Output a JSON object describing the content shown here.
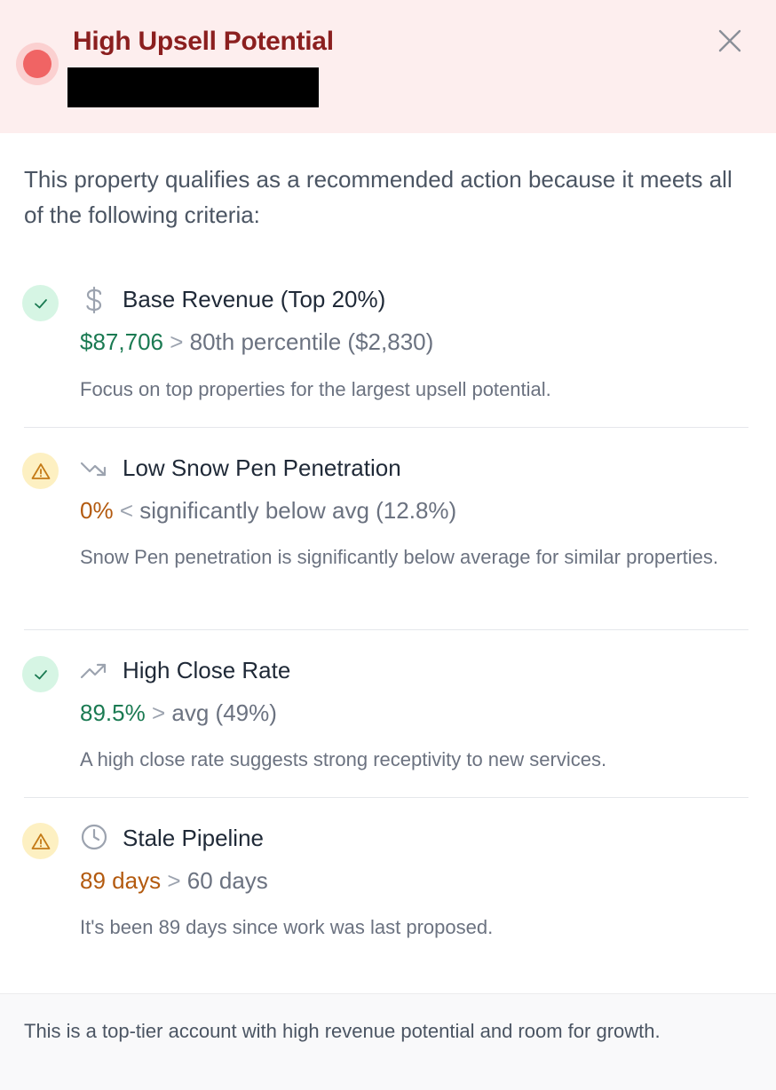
{
  "header": {
    "title": "High Upsell Potential",
    "status_color": "#f06464"
  },
  "intro": "This property qualifies as a recommended action because it meets all of the following criteria:",
  "criteria": [
    {
      "status": "ok",
      "icon": "dollar-icon",
      "title": "Base Revenue (Top 20%)",
      "value": "$87,706",
      "comparator": ">",
      "reference": "80th percentile ($2,830)",
      "description": "Focus on top properties for the largest upsell potential."
    },
    {
      "status": "warning",
      "icon": "trending-down-icon",
      "title": "Low Snow Pen Penetration",
      "value": "0%",
      "comparator": "<",
      "reference": "significantly below avg (12.8%)",
      "description": "Snow Pen penetration is significantly below average for similar properties."
    },
    {
      "status": "ok",
      "icon": "trending-up-icon",
      "title": "High Close Rate",
      "value": "89.5%",
      "comparator": ">",
      "reference": "avg (49%)",
      "description": "A high close rate suggests strong receptivity to new services."
    },
    {
      "status": "warning",
      "icon": "clock-icon",
      "title": "Stale Pipeline",
      "value": "89 days",
      "comparator": ">",
      "reference": "60 days",
      "description": "It's been 89 days since work was last proposed."
    }
  ],
  "footer": {
    "summary": "This is a top-tier account with high revenue potential and room for growth."
  },
  "colors": {
    "ok": "#1a7a52",
    "warning": "#b35a0f",
    "header_bg": "#fdeeee",
    "title": "#8b1f1f"
  }
}
